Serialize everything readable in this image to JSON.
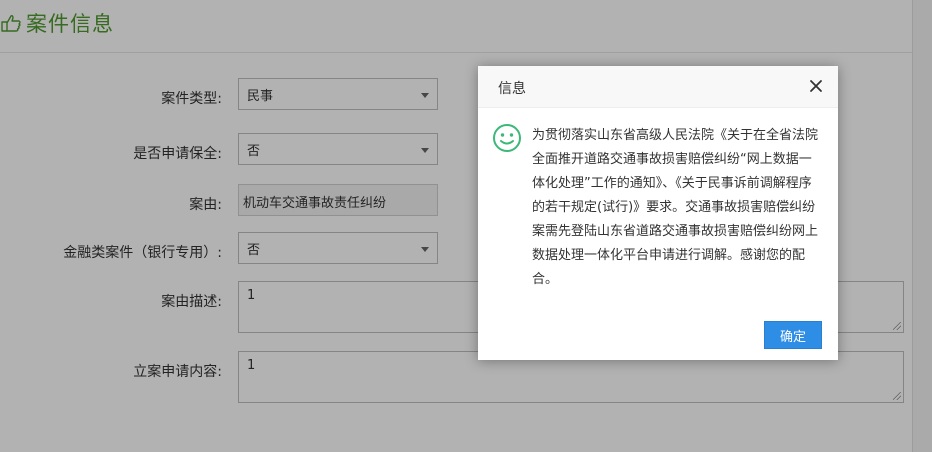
{
  "header": {
    "title": "案件信息",
    "icon": "hand-pointing-icon"
  },
  "form": {
    "case_type": {
      "label": "案件类型:",
      "value": "民事"
    },
    "preservation": {
      "label": "是否申请保全:",
      "value": "否"
    },
    "cause": {
      "label": "案由:",
      "value": "机动车交通事故责任纠纷"
    },
    "financial": {
      "label": "金融类案件（银行专用）:",
      "value": "否"
    },
    "cause_desc": {
      "label": "案由描述:",
      "value": "1"
    },
    "filing_content": {
      "label": "立案申请内容:",
      "value": "1"
    }
  },
  "dialog": {
    "title": "信息",
    "icon": "smile-icon",
    "message": "为贯彻落实山东省高级人民法院《关于在全省法院全面推开道路交通事故损害赔偿纠纷“网上数据一体化处理”工作的通知》、《关于民事诉前调解程序的若干规定(试行)》要求。交通事故损害赔偿纠纷案需先登陆山东省道路交通事故损害赔偿纠纷网上数据处理一体化平台申请进行调解。感谢您的配合。",
    "ok_label": "确定"
  },
  "colors": {
    "accent": "#2e8de5",
    "title_green": "#4e9a2f",
    "smile_green": "#3cb878"
  }
}
